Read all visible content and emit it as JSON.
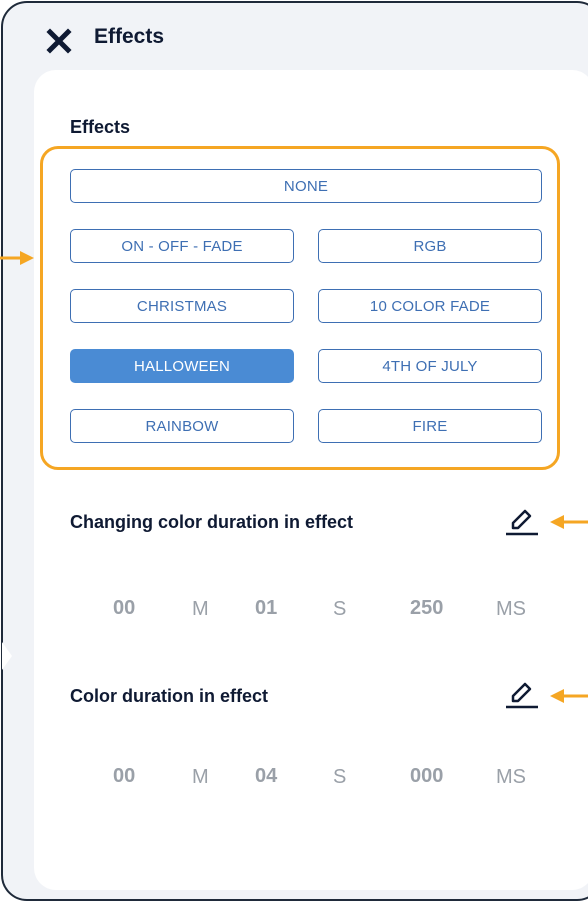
{
  "header": {
    "title": "Effects"
  },
  "effects": {
    "section_label": "Effects",
    "buttons": [
      {
        "label": "NONE",
        "selected": false
      },
      {
        "label": "ON - OFF - FADE",
        "selected": false
      },
      {
        "label": "RGB",
        "selected": false
      },
      {
        "label": "CHRISTMAS",
        "selected": false
      },
      {
        "label": "10 COLOR FADE",
        "selected": false
      },
      {
        "label": "HALLOWEEN",
        "selected": true
      },
      {
        "label": "4TH OF JULY",
        "selected": false
      },
      {
        "label": "RAINBOW",
        "selected": false
      },
      {
        "label": "FIRE",
        "selected": false
      }
    ]
  },
  "changing_duration": {
    "label": "Changing color duration in effect",
    "minutes": "00",
    "m_unit": "M",
    "seconds": "01",
    "s_unit": "S",
    "ms": "250",
    "ms_unit": "MS"
  },
  "color_duration": {
    "label": "Color duration in effect",
    "minutes": "00",
    "m_unit": "M",
    "seconds": "04",
    "s_unit": "S",
    "ms": "000",
    "ms_unit": "MS"
  },
  "colors": {
    "accent": "#4a8bd4",
    "button_border": "#3e6fb3",
    "highlight": "#f5a623",
    "title": "#0f1a33",
    "muted": "#9aa0a8"
  },
  "icons": [
    "close-icon",
    "edit-icon",
    "annotation-arrow"
  ]
}
